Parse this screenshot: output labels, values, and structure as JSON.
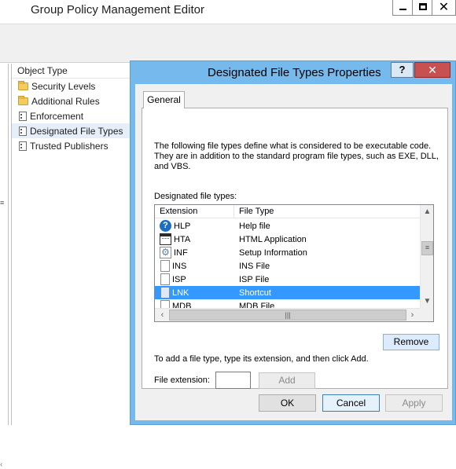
{
  "main_window": {
    "title": "Group Policy Management Editor",
    "close_glyph": "✕"
  },
  "details": {
    "header": "Object Type",
    "items": [
      {
        "label": "Security Levels",
        "icon": "folder-icon"
      },
      {
        "label": "Additional Rules",
        "icon": "folder-icon"
      },
      {
        "label": "Enforcement",
        "icon": "policy-doc-icon"
      },
      {
        "label": "Designated File Types",
        "icon": "policy-doc-icon",
        "selected": true
      },
      {
        "label": "Trusted Publishers",
        "icon": "policy-doc-icon"
      }
    ]
  },
  "dialog": {
    "title": "Designated File Types Properties",
    "help_glyph": "?",
    "close_glyph": "✕",
    "tab_general": "General",
    "description": "The following file types define what is considered to be executable code. They are in addition to the standard program file types, such as EXE, DLL, and VBS.",
    "list_label": "Designated file types:",
    "columns": {
      "extension": "Extension",
      "file_type": "File Type"
    },
    "rows": [
      {
        "ext": "HLP",
        "type": "Help file",
        "icon": "help-file-icon",
        "glyph": "?"
      },
      {
        "ext": "HTA",
        "type": "HTML Application",
        "icon": "application-icon"
      },
      {
        "ext": "INF",
        "type": "Setup Information",
        "icon": "settings-file-icon",
        "glyph": "⚙"
      },
      {
        "ext": "INS",
        "type": "INS File",
        "icon": "blank-file-icon"
      },
      {
        "ext": "ISP",
        "type": "ISP File",
        "icon": "blank-file-icon"
      },
      {
        "ext": "LNK",
        "type": "Shortcut",
        "icon": "shortcut-file-icon",
        "selected": true
      },
      {
        "ext": "MDB",
        "type": "MDB File",
        "icon": "blank-file-icon"
      }
    ],
    "remove_label": "Remove",
    "hint": "To add a file type, type its extension, and then click Add.",
    "file_extension_label": "File extension:",
    "file_extension_value": "",
    "add_label": "Add",
    "ok_label": "OK",
    "cancel_label": "Cancel",
    "apply_label": "Apply"
  },
  "colors": {
    "dialog_frame": "#76b9ed",
    "close_button": "#c75050",
    "selection": "#3399ff"
  }
}
